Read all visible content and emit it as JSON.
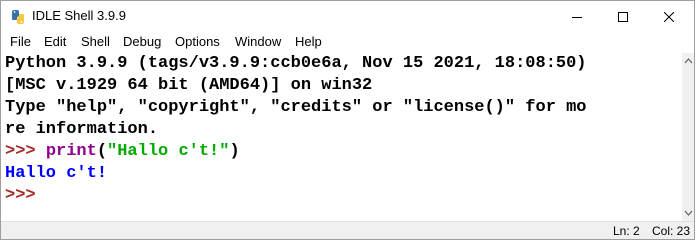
{
  "window": {
    "title": "IDLE Shell 3.9.9",
    "app_icon": "python-feather-icon"
  },
  "menu": {
    "items": [
      "File",
      "Edit",
      "Shell",
      "Debug",
      "Options",
      "Window",
      "Help"
    ]
  },
  "shell": {
    "banner_1": "Python 3.9.9 (tags/v3.9.9:ccb0e6a, Nov 15 2021, 18:08:50)",
    "banner_2": "[MSC v.1929 64 bit (AMD64)] on win32",
    "banner_3": "Type \"help\", \"copyright\", \"credits\" or \"license()\" for mo",
    "banner_4": "re information.",
    "prompt": ">>>",
    "cmd_builtin": "print",
    "cmd_open": "(",
    "cmd_string": "\"Hallo c't!\"",
    "cmd_close": ")",
    "output": "Hallo c't!",
    "prompt_2": ">>>"
  },
  "status": {
    "line": "Ln: 2",
    "column": "Col: 23"
  },
  "colors": {
    "prompt": "#a52a2a",
    "builtin": "#900090",
    "string": "#00aa00",
    "output": "#0000ff"
  }
}
